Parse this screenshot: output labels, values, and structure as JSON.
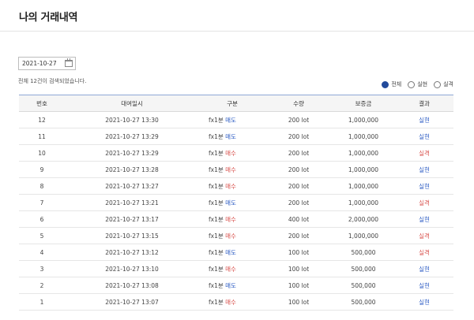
{
  "page": {
    "title": "나의 거래내역"
  },
  "search": {
    "date_value": "2021-10-27",
    "summary": "전체 12건이 검색되었습니다."
  },
  "filters": [
    {
      "label": "전체",
      "checked": true
    },
    {
      "label": "실현",
      "checked": false
    },
    {
      "label": "실격",
      "checked": false
    }
  ],
  "table": {
    "headers": [
      "번호",
      "대여일시",
      "구분",
      "수량",
      "보증금",
      "결과"
    ],
    "rows": [
      {
        "no": "12",
        "datetime": "2021-10-27 13:30",
        "type_prefix": "fx1분",
        "type_action": "매도",
        "action_kind": "sell",
        "qty": "200 lot",
        "deposit": "1,000,000",
        "result": "실현",
        "result_kind": "success"
      },
      {
        "no": "11",
        "datetime": "2021-10-27 13:29",
        "type_prefix": "fx1분",
        "type_action": "매도",
        "action_kind": "sell",
        "qty": "200 lot",
        "deposit": "1,000,000",
        "result": "실현",
        "result_kind": "success"
      },
      {
        "no": "10",
        "datetime": "2021-10-27 13:29",
        "type_prefix": "fx1분",
        "type_action": "매수",
        "action_kind": "buy",
        "qty": "200 lot",
        "deposit": "1,000,000",
        "result": "실격",
        "result_kind": "fail"
      },
      {
        "no": "9",
        "datetime": "2021-10-27 13:28",
        "type_prefix": "fx1분",
        "type_action": "매수",
        "action_kind": "buy",
        "qty": "200 lot",
        "deposit": "1,000,000",
        "result": "실현",
        "result_kind": "success"
      },
      {
        "no": "8",
        "datetime": "2021-10-27 13:27",
        "type_prefix": "fx1분",
        "type_action": "매수",
        "action_kind": "buy",
        "qty": "200 lot",
        "deposit": "1,000,000",
        "result": "실현",
        "result_kind": "success"
      },
      {
        "no": "7",
        "datetime": "2021-10-27 13:21",
        "type_prefix": "fx1분",
        "type_action": "매도",
        "action_kind": "sell",
        "qty": "200 lot",
        "deposit": "1,000,000",
        "result": "실격",
        "result_kind": "fail"
      },
      {
        "no": "6",
        "datetime": "2021-10-27 13:17",
        "type_prefix": "fx1분",
        "type_action": "매수",
        "action_kind": "buy",
        "qty": "400 lot",
        "deposit": "2,000,000",
        "result": "실현",
        "result_kind": "success"
      },
      {
        "no": "5",
        "datetime": "2021-10-27 13:15",
        "type_prefix": "fx1분",
        "type_action": "매수",
        "action_kind": "buy",
        "qty": "200 lot",
        "deposit": "1,000,000",
        "result": "실격",
        "result_kind": "fail"
      },
      {
        "no": "4",
        "datetime": "2021-10-27 13:12",
        "type_prefix": "fx1분",
        "type_action": "매도",
        "action_kind": "sell",
        "qty": "100 lot",
        "deposit": "500,000",
        "result": "실격",
        "result_kind": "fail"
      },
      {
        "no": "3",
        "datetime": "2021-10-27 13:10",
        "type_prefix": "fx1분",
        "type_action": "매수",
        "action_kind": "buy",
        "qty": "100 lot",
        "deposit": "500,000",
        "result": "실현",
        "result_kind": "success"
      },
      {
        "no": "2",
        "datetime": "2021-10-27 13:08",
        "type_prefix": "fx1분",
        "type_action": "매도",
        "action_kind": "sell",
        "qty": "100 lot",
        "deposit": "500,000",
        "result": "실현",
        "result_kind": "success"
      },
      {
        "no": "1",
        "datetime": "2021-10-27 13:07",
        "type_prefix": "fx1분",
        "type_action": "매수",
        "action_kind": "buy",
        "qty": "100 lot",
        "deposit": "500,000",
        "result": "실현",
        "result_kind": "success"
      }
    ]
  },
  "colors": {
    "accent": "#234a9b",
    "sell": "#2f5ec4",
    "buy": "#d9534f",
    "success": "#2f5ec4",
    "fail": "#d9534f"
  }
}
